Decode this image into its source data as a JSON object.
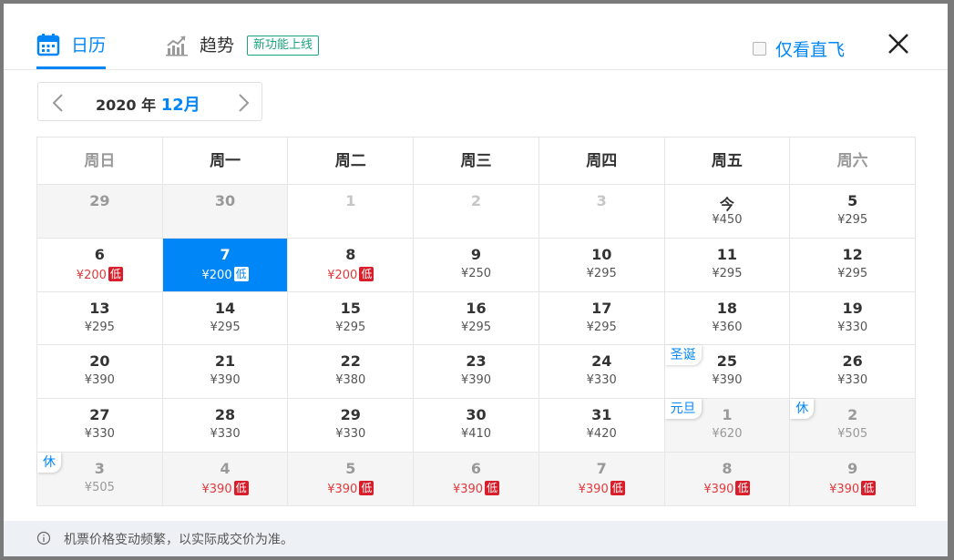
{
  "tabs": {
    "calendar": "日历",
    "trend": "趋势",
    "new_badge": "新功能上线",
    "direct_only": "仅看直飞"
  },
  "month": {
    "year": "2020",
    "year_label": "年",
    "month": "12月"
  },
  "weekdays": [
    "周日",
    "周一",
    "周二",
    "周三",
    "周四",
    "周五",
    "周六"
  ],
  "low_tag": "低",
  "colors": {
    "accent": "#0086f6",
    "low": "#e4393c",
    "badge_green": "#1aa37c"
  },
  "rows": [
    [
      {
        "day": "29",
        "price": "",
        "state": "disabled"
      },
      {
        "day": "30",
        "price": "",
        "state": "disabled"
      },
      {
        "day": "1",
        "price": "",
        "state": "muted"
      },
      {
        "day": "2",
        "price": "",
        "state": "muted"
      },
      {
        "day": "3",
        "price": "",
        "state": "muted"
      },
      {
        "day": "今",
        "price": "¥450",
        "state": "normal"
      },
      {
        "day": "5",
        "price": "¥295",
        "state": "normal"
      }
    ],
    [
      {
        "day": "6",
        "price": "¥200",
        "low": true,
        "state": "normal"
      },
      {
        "day": "7",
        "price": "¥200",
        "low": true,
        "state": "selected"
      },
      {
        "day": "8",
        "price": "¥200",
        "low": true,
        "state": "normal"
      },
      {
        "day": "9",
        "price": "¥250",
        "state": "normal"
      },
      {
        "day": "10",
        "price": "¥295",
        "state": "normal"
      },
      {
        "day": "11",
        "price": "¥295",
        "state": "normal"
      },
      {
        "day": "12",
        "price": "¥295",
        "state": "normal"
      }
    ],
    [
      {
        "day": "13",
        "price": "¥295",
        "state": "normal"
      },
      {
        "day": "14",
        "price": "¥295",
        "state": "normal"
      },
      {
        "day": "15",
        "price": "¥295",
        "state": "normal"
      },
      {
        "day": "16",
        "price": "¥295",
        "state": "normal"
      },
      {
        "day": "17",
        "price": "¥295",
        "state": "normal"
      },
      {
        "day": "18",
        "price": "¥360",
        "state": "normal"
      },
      {
        "day": "19",
        "price": "¥330",
        "state": "normal"
      }
    ],
    [
      {
        "day": "20",
        "price": "¥390",
        "state": "normal"
      },
      {
        "day": "21",
        "price": "¥390",
        "state": "normal"
      },
      {
        "day": "22",
        "price": "¥380",
        "state": "normal"
      },
      {
        "day": "23",
        "price": "¥390",
        "state": "normal"
      },
      {
        "day": "24",
        "price": "¥330",
        "state": "normal"
      },
      {
        "day": "25",
        "price": "¥390",
        "state": "normal",
        "holiday": "圣诞"
      },
      {
        "day": "26",
        "price": "¥330",
        "state": "normal"
      }
    ],
    [
      {
        "day": "27",
        "price": "¥330",
        "state": "normal"
      },
      {
        "day": "28",
        "price": "¥330",
        "state": "normal"
      },
      {
        "day": "29",
        "price": "¥330",
        "state": "normal"
      },
      {
        "day": "30",
        "price": "¥410",
        "state": "normal"
      },
      {
        "day": "31",
        "price": "¥420",
        "state": "normal"
      },
      {
        "day": "1",
        "price": "¥620",
        "state": "disabled",
        "holiday": "元旦"
      },
      {
        "day": "2",
        "price": "¥505",
        "state": "disabled",
        "holiday": "休"
      }
    ],
    [
      {
        "day": "3",
        "price": "¥505",
        "state": "disabled",
        "holiday": "休"
      },
      {
        "day": "4",
        "price": "¥390",
        "low": true,
        "state": "disabled"
      },
      {
        "day": "5",
        "price": "¥390",
        "low": true,
        "state": "disabled"
      },
      {
        "day": "6",
        "price": "¥390",
        "low": true,
        "state": "disabled"
      },
      {
        "day": "7",
        "price": "¥390",
        "low": true,
        "state": "disabled"
      },
      {
        "day": "8",
        "price": "¥390",
        "low": true,
        "state": "disabled"
      },
      {
        "day": "9",
        "price": "¥390",
        "low": true,
        "state": "disabled"
      }
    ]
  ],
  "footer": {
    "note": "机票价格变动频繁，以实际成交价为准。"
  }
}
